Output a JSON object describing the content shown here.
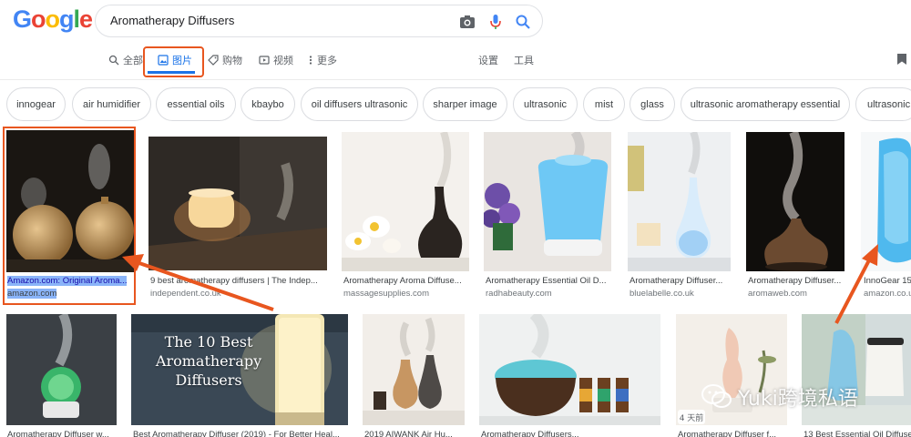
{
  "logo": {
    "letters": [
      "G",
      "o",
      "o",
      "g",
      "l",
      "e"
    ],
    "colors": [
      "#4285f4",
      "#ea4335",
      "#fbbc05",
      "#4285f4",
      "#34a853",
      "#ea4335"
    ]
  },
  "search": {
    "query": "Aromatherapy Diffusers"
  },
  "tabs": {
    "all": "全部",
    "images": "图片",
    "shopping": "购物",
    "videos": "视频",
    "more": "更多",
    "settings": "设置",
    "tools": "工具"
  },
  "chips": [
    "innogear",
    "air humidifier",
    "essential oils",
    "kbaybo",
    "oil diffusers ultrasonic",
    "sharper image",
    "ultrasonic",
    "mist",
    "glass",
    "ultrasonic aromatherapy essential",
    "ultrasonic"
  ],
  "results_row1": [
    {
      "caption": "Amazon.com: Original Aroma...",
      "source": "amazon.com"
    },
    {
      "caption": "9 best aromatherapy diffusers | The Indep...",
      "source": "independent.co.uk"
    },
    {
      "caption": "Aromatherapy Aroma Diffuse...",
      "source": "massagesupplies.com"
    },
    {
      "caption": "Aromatherapy Essential Oil D...",
      "source": "radhabeauty.com"
    },
    {
      "caption": "Aromatherapy Diffuser...",
      "source": "bluelabelle.co.uk"
    },
    {
      "caption": "Aromatherapy Diffuser...",
      "source": "aromaweb.com"
    },
    {
      "caption": "InnoGear 15",
      "source": "amazon.co.u"
    }
  ],
  "results_row2": [
    {
      "caption": "Aromatherapy Diffuser w..."
    },
    {
      "caption": "Best Aromatherapy Diffuser (2019) - For Better Heal..."
    },
    {
      "caption": "2019 AIWANK Air Hu..."
    },
    {
      "caption": "Aromatherapy Diffusers..."
    },
    {
      "caption": "Aromatherapy Diffuser f..."
    },
    {
      "caption": "13 Best Essential Oil Diffuse..."
    }
  ],
  "thumb_text": {
    "line1": "The 10 Best",
    "line2": "Aromatherapy",
    "line3": "Diffusers"
  },
  "badge": "4 天前",
  "watermark": "Yuki跨境私语"
}
